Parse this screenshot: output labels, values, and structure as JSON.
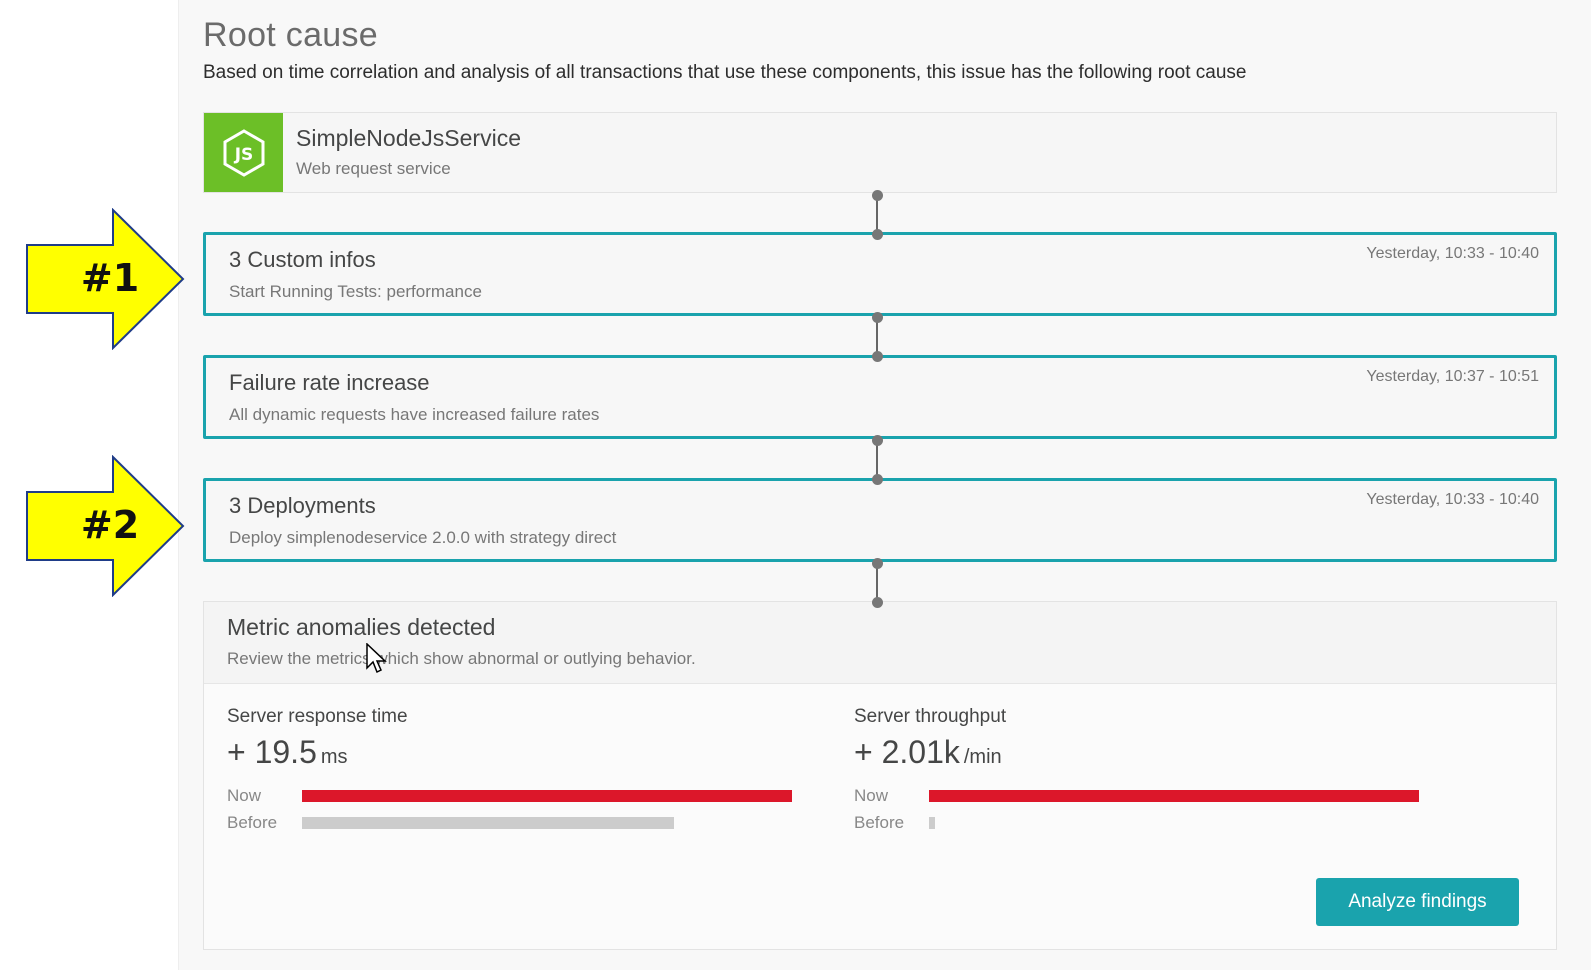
{
  "header": {
    "title": "Root cause",
    "subtitle": "Based on time correlation and analysis of all transactions that use these components, this issue has the following root cause"
  },
  "service": {
    "name": "SimpleNodeJsService",
    "type": "Web request service",
    "logo_text": "JS",
    "icon": "nodejs-icon",
    "logo_color": "#6cbf27"
  },
  "events": [
    {
      "title": "3 Custom infos",
      "description": "Start Running Tests: performance",
      "time": "Yesterday, 10:33 - 10:40"
    },
    {
      "title": "Failure rate increase",
      "description": "All dynamic requests have increased failure rates",
      "time": "Yesterday, 10:37 - 10:51"
    },
    {
      "title": "3 Deployments",
      "description": "Deploy simplenodeservice 2.0.0 with strategy direct",
      "time": "Yesterday, 10:33 - 10:40"
    }
  ],
  "metrics": {
    "title": "Metric anomalies detected",
    "subtitle": "Review the metrics which show abnormal or outlying behavior.",
    "items": [
      {
        "label": "Server response time",
        "value": "+ 19.5",
        "unit": "ms",
        "now_label": "Now",
        "before_label": "Before",
        "now_fraction": 1.0,
        "before_fraction": 0.76
      },
      {
        "label": "Server throughput",
        "value": "+ 2.01k",
        "unit": "/min",
        "now_label": "Now",
        "before_label": "Before",
        "now_fraction": 1.0,
        "before_fraction": 0.012
      }
    ],
    "analyze_button": "Analyze findings"
  },
  "annotations": [
    {
      "label": "#1"
    },
    {
      "label": "#2"
    }
  ],
  "colors": {
    "accent": "#1aa3ad",
    "now_bar": "#dc172a",
    "before_bar": "#cccccc",
    "arrow_fill": "#ffff00",
    "arrow_stroke": "#1f3c88"
  }
}
